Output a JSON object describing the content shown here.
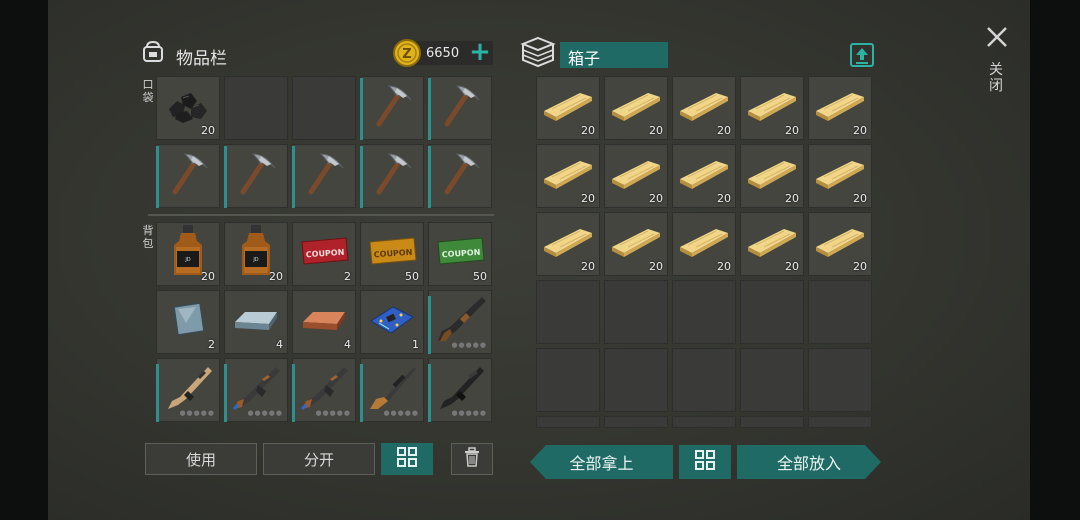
{
  "inventory": {
    "title": "物品栏",
    "currency_amount": "6650",
    "pocket_label": "口袋",
    "backpack_label": "背包",
    "pocket_slots": [
      {
        "icon": "coal-icon",
        "count": "20"
      },
      {
        "icon": "",
        "count": ""
      },
      {
        "icon": "",
        "count": ""
      },
      {
        "icon": "pickaxe-icon",
        "count": ""
      },
      {
        "icon": "pickaxe-icon",
        "count": ""
      },
      {
        "icon": "pickaxe-icon",
        "count": ""
      },
      {
        "icon": "pickaxe-icon",
        "count": ""
      },
      {
        "icon": "pickaxe-icon",
        "count": ""
      },
      {
        "icon": "pickaxe-icon",
        "count": ""
      },
      {
        "icon": "pickaxe-icon",
        "count": ""
      }
    ],
    "coupon_texts": {
      "red": "COUPON",
      "orange": "COUPON",
      "green": "COUPON"
    },
    "backpack_slots": [
      {
        "icon": "whiskey-bottle-icon",
        "count": "20"
      },
      {
        "icon": "whiskey-bottle-icon",
        "count": "20"
      },
      {
        "icon": "red-coupon-icon",
        "count": "2"
      },
      {
        "icon": "orange-coupon-icon",
        "count": "50"
      },
      {
        "icon": "green-coupon-icon",
        "count": "50"
      },
      {
        "icon": "metal-plate-icon",
        "count": "2"
      },
      {
        "icon": "iron-ingot-icon",
        "count": "4"
      },
      {
        "icon": "copper-ingot-icon",
        "count": "4"
      },
      {
        "icon": "circuit-board-icon",
        "count": "1"
      },
      {
        "icon": "shotgun-icon",
        "count": ""
      },
      {
        "icon": "assault-rifle-tan-icon",
        "count": ""
      },
      {
        "icon": "ak-rifle-icon",
        "count": ""
      },
      {
        "icon": "ak-rifle-icon",
        "count": ""
      },
      {
        "icon": "hunting-rifle-icon",
        "count": ""
      },
      {
        "icon": "black-rifle-icon",
        "count": ""
      }
    ],
    "buttons": {
      "use": "使用",
      "split": "分开"
    }
  },
  "chest": {
    "title": "箱子",
    "slots": [
      "20",
      "20",
      "20",
      "20",
      "20",
      "20",
      "20",
      "20",
      "20",
      "20",
      "20",
      "20",
      "20",
      "20",
      "20"
    ],
    "take_all": "全部拿上",
    "put_all": "全部放入"
  },
  "close_label": "关闭",
  "colors": {
    "teal": "#1f6a64",
    "bright_teal": "#2bb3a3",
    "gold": "#e0b21e"
  }
}
